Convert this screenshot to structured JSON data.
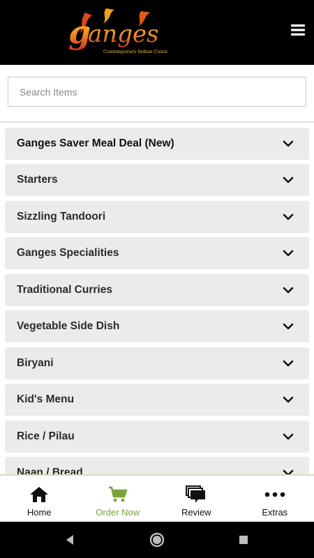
{
  "header": {
    "logo_text": "ganges",
    "logo_tagline": "Contemporary Indian Cuisine",
    "menu_icon": "hamburger-icon"
  },
  "search": {
    "placeholder": "Search Items",
    "value": ""
  },
  "categories": [
    {
      "label": "Ganges Saver Meal Deal (New)"
    },
    {
      "label": "Starters"
    },
    {
      "label": "Sizzling Tandoori"
    },
    {
      "label": "Ganges Specialities"
    },
    {
      "label": "Traditional Curries"
    },
    {
      "label": "Vegetable Side Dish"
    },
    {
      "label": "Biryani"
    },
    {
      "label": "Kid's Menu"
    },
    {
      "label": "Rice / Pilau"
    },
    {
      "label": "Naan / Bread"
    }
  ],
  "bottom_nav": [
    {
      "label": "Home",
      "icon": "home-icon",
      "active": false
    },
    {
      "label": "Order Now",
      "icon": "cart-icon",
      "active": true
    },
    {
      "label": "Review",
      "icon": "chat-bubbles-icon",
      "active": false
    },
    {
      "label": "Extras",
      "icon": "more-dots-icon",
      "active": false
    }
  ],
  "colors": {
    "header_bg": "#000000",
    "row_bg": "#ebebeb",
    "accent_green": "#7aa33a",
    "logo_orange": "#e8651c",
    "logo_yellow": "#f5c518"
  }
}
